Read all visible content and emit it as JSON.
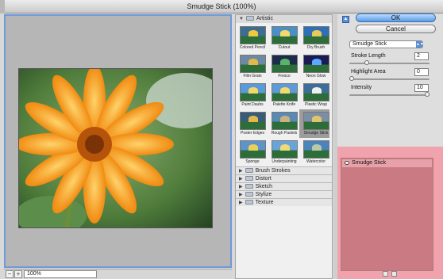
{
  "window": {
    "title": "Smudge Stick (100%)"
  },
  "zoom": {
    "minus": "−",
    "plus": "+",
    "value": "100%"
  },
  "gallery": {
    "artistic_folder": "Artistic",
    "thumbs": [
      {
        "label": "Colored Pencil"
      },
      {
        "label": "Cutout"
      },
      {
        "label": "Dry Brush"
      },
      {
        "label": "Film Grain"
      },
      {
        "label": "Fresco"
      },
      {
        "label": "Neon Glow"
      },
      {
        "label": "Paint Daubs"
      },
      {
        "label": "Palette Knife"
      },
      {
        "label": "Plastic Wrap"
      },
      {
        "label": "Poster Edges"
      },
      {
        "label": "Rough Pastels"
      },
      {
        "label": "Smudge Stick"
      },
      {
        "label": "Sponge"
      },
      {
        "label": "Underpainting"
      },
      {
        "label": "Watercolor"
      }
    ],
    "selected": "Smudge Stick",
    "folders": [
      "Brush Strokes",
      "Distort",
      "Sketch",
      "Stylize",
      "Texture"
    ]
  },
  "controls": {
    "ok": "OK",
    "cancel": "Cancel",
    "filter_select": "Smudge Stick",
    "params": [
      {
        "label": "Stroke Length",
        "value": "2",
        "level": 0.2
      },
      {
        "label": "Highlight Area",
        "value": "0",
        "level": 0.0
      },
      {
        "label": "Intensity",
        "value": "10",
        "level": 1.0
      }
    ]
  },
  "layers": {
    "items": [
      {
        "label": "Smudge Stick"
      }
    ]
  },
  "colors": {
    "accent": "#5b8fd6",
    "layers_bg": "#f0a3ac",
    "selection": "#9c9c9c"
  }
}
